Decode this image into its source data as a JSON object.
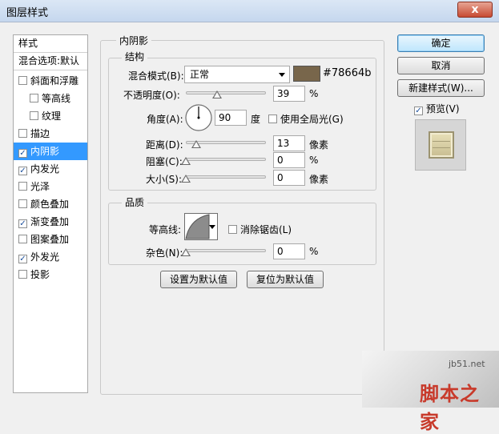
{
  "window": {
    "title": "图层样式",
    "close_label": "x"
  },
  "left_panel": {
    "header": "样式",
    "blend_defaults": "混合选项:默认",
    "items": [
      {
        "label": "斜面和浮雕",
        "checked": false
      },
      {
        "label": "等高线",
        "checked": false
      },
      {
        "label": "纹理",
        "checked": false
      },
      {
        "label": "描边",
        "checked": false
      },
      {
        "label": "内阴影",
        "checked": true
      },
      {
        "label": "内发光",
        "checked": true
      },
      {
        "label": "光泽",
        "checked": false
      },
      {
        "label": "颜色叠加",
        "checked": false
      },
      {
        "label": "渐变叠加",
        "checked": true
      },
      {
        "label": "图案叠加",
        "checked": false
      },
      {
        "label": "外发光",
        "checked": true
      },
      {
        "label": "投影",
        "checked": false
      }
    ]
  },
  "inner_shadow": {
    "title": "内阴影",
    "structure": {
      "title": "结构",
      "blend_mode_label": "混合模式(B):",
      "blend_mode_value": "正常",
      "color_hex": "#78664b",
      "color_label": "#78664b",
      "opacity_label": "不透明度(O):",
      "opacity_value": "39",
      "opacity_unit": "%",
      "angle_label": "角度(A):",
      "angle_value": "90",
      "angle_unit": "度",
      "global_light_label": "使用全局光(G)",
      "global_light_checked": false,
      "distance_label": "距离(D):",
      "distance_value": "13",
      "distance_unit": "像素",
      "choke_label": "阻塞(C):",
      "choke_value": "0",
      "choke_unit": "%",
      "size_label": "大小(S):",
      "size_value": "0",
      "size_unit": "像素"
    },
    "quality": {
      "title": "品质",
      "contour_label": "等高线:",
      "anti_alias_label": "消除锯齿(L)",
      "anti_alias_checked": false,
      "noise_label": "杂色(N):",
      "noise_value": "0",
      "noise_unit": "%"
    },
    "make_default_label": "设置为默认值",
    "reset_default_label": "复位为默认值"
  },
  "right_buttons": {
    "ok_label": "确定",
    "cancel_label": "取消",
    "new_style_label": "新建样式(W)...",
    "preview_label": "预览(V)",
    "preview_checked": true
  },
  "watermark": {
    "site": "jb51.net",
    "brand": "脚本之家"
  }
}
